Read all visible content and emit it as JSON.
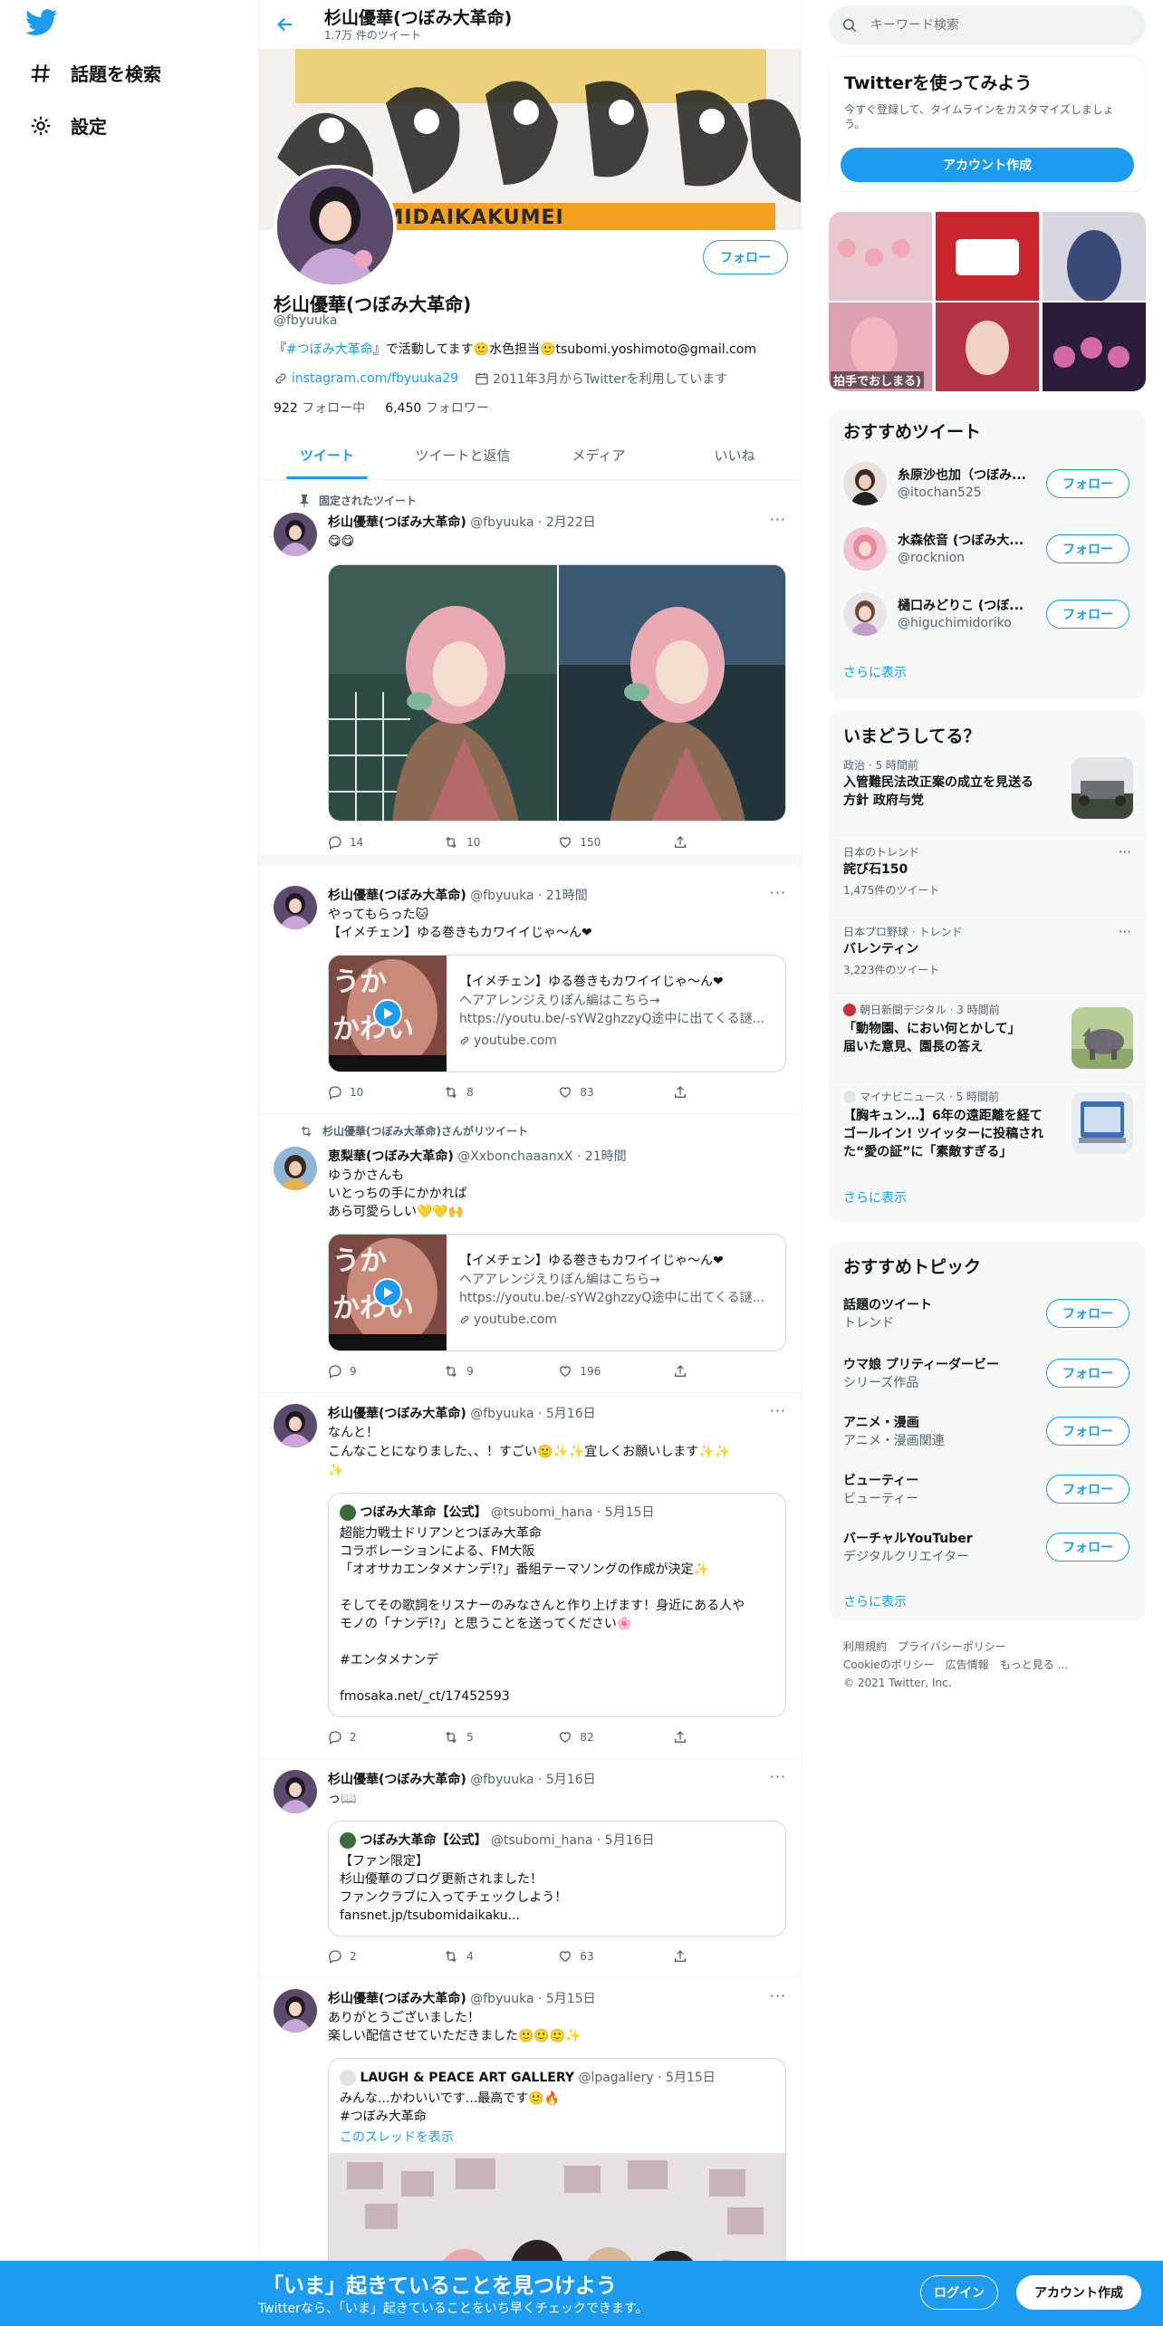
{
  "nav": {
    "explore_label": "話題を検索",
    "settings_label": "設定"
  },
  "header": {
    "name": "杉山優華(つぼみ大革命)",
    "tweet_count": "1.7万 件のツイート"
  },
  "banner": {
    "text": "BOMIDAIKAKUMEI"
  },
  "profile": {
    "name": "杉山優華(つぼみ大革命)",
    "handle": "@fbyuuka",
    "follow_label": "フォロー",
    "bio_prefix": "『",
    "bio_hashtag": "#つぼみ大革命",
    "bio_rest": "』で活動してます🙂水色担当🙂tsubomi.yoshimoto@gmail.com",
    "link": "instagram.com/fbyuuka29",
    "joined": "2011年3月からTwitterを利用しています",
    "following_count": "922",
    "following_label": "フォロー中",
    "followers_count": "6,450",
    "followers_label": "フォロワー"
  },
  "tabs": [
    "ツイート",
    "ツイートと返信",
    "メディア",
    "いいね"
  ],
  "tweets": [
    {
      "pinned_label": "固定されたツイート",
      "name": "杉山優華(つぼみ大革命)",
      "meta": "@fbyuuka · 2月22日",
      "text": "😋😋",
      "reply": "14",
      "retweet": "10",
      "like": "150"
    },
    {
      "name": "杉山優華(つぼみ大革命)",
      "meta": "@fbyuuka · 21時間",
      "text": "やってもらった🐱\n【イメチェン】ゆる巻きもカワイイじゃ〜ん❤",
      "card_thumb_text": "うか\nかわい",
      "card_title": "【イメチェン】ゆる巻きもカワイイじゃ〜ん❤",
      "card_desc": "ヘアアレンジえりぽん編はこちら→\nhttps://youtu.be/-sYW2ghzzyQ途中に出てくる謎...",
      "card_url": "youtube.com",
      "reply": "10",
      "retweet": "8",
      "like": "83"
    },
    {
      "social": "杉山優華(つぼみ大革命)さんがリツイート",
      "name": "恵梨華(つぼみ大革命)",
      "meta": "@XxbonchaaanxX · 21時間",
      "text": "ゆうかさんも\nいとっちの手にかかれば\nあら可愛らしい💛💛🙌",
      "card_thumb_text": "うか\nかわい",
      "card_title": "【イメチェン】ゆる巻きもカワイイじゃ〜ん❤",
      "card_desc": "ヘアアレンジえりぽん編はこちら→\nhttps://youtu.be/-sYW2ghzzyQ途中に出てくる謎...",
      "card_url": "youtube.com",
      "reply": "9",
      "retweet": "9",
      "like": "196"
    },
    {
      "name": "杉山優華(つぼみ大革命)",
      "meta": "@fbyuuka · 5月16日",
      "text": "なんと！\nこんなことになりました、、！すごい🙂✨✨宜しくお願いします✨✨\n✨",
      "quote_name": "つぼみ大革命【公式】",
      "quote_meta": "@tsubomi_hana · 5月15日",
      "quote_text": "超能力戦士ドリアンとつぼみ大革命\nコラボレーションによる、FM大阪\n「オオサカエンタメナンデ!?」番組テーマソングの作成が決定✨\n\nそしてその歌詞をリスナーのみなさんと作り上げます！身近にある人や\nモノの「ナンデ!?」と思うことを送ってください🌸\n\n#エンタメナンデ\n\nfmosaka.net/_ct/17452593",
      "reply": "2",
      "retweet": "5",
      "like": "82"
    },
    {
      "name": "杉山優華(つぼみ大革命)",
      "meta": "@fbyuuka · 5月16日",
      "text": "っ📖",
      "quote_name": "つぼみ大革命【公式】",
      "quote_meta": "@tsubomi_hana · 5月16日",
      "quote_text": "【ファン限定】\n杉山優華のブログ更新されました！\nファンクラブに入ってチェックしよう！\nfansnet.jp/tsubomidaikaku...",
      "reply": "2",
      "retweet": "4",
      "like": "63"
    },
    {
      "name": "杉山優華(つぼみ大革命)",
      "meta": "@fbyuuka · 5月15日",
      "text": "ありがとうございました！\n楽しい配信させていただきました🙂🙂🙂✨",
      "quote_name": "LAUGH & PEACE ART GALLERY",
      "quote_meta": "@lpagallery · 5月15日",
      "quote_text": "みんな...かわいいです...最高です🙂🔥\n#つぼみ大革命",
      "quote_thread": "このスレッドを表示"
    }
  ],
  "sidebar": {
    "search_placeholder": "キーワード検索",
    "signup": {
      "title": "Twitterを使ってみよう",
      "desc": "今すぐ登録して、タイムラインをカスタマイズしましょう。",
      "button": "アカウント作成"
    },
    "media_caption": "拍手でおしまる)",
    "recommended": {
      "title": "おすすめツイート",
      "follow_label": "フォロー",
      "users": [
        {
          "name": "糸原沙也加（つぼみ...",
          "handle": "@itochan525"
        },
        {
          "name": "水森依音 (つぼみ大...",
          "handle": "@rocknion"
        },
        {
          "name": "樋口みどりこ (つぼ...",
          "handle": "@higuchimidoriko"
        }
      ],
      "more": "さらに表示"
    },
    "trends": {
      "title": "いまどうしてる？",
      "items": [
        {
          "meta": "政治 · 5 時間前",
          "title": "入管難民法改正案の成立を見送る\n方針 政府与党"
        },
        {
          "meta": "日本のトレンド",
          "title": "詫び石150",
          "count": "1,475件のツイート"
        },
        {
          "meta": "日本プロ野球 · トレンド",
          "title": "バレンティン",
          "count": "3,223件のツイート"
        },
        {
          "meta": "朝日新聞デジタル · 3 時間前",
          "title": "「動物園、におい何とかして」\n届いた意見、園長の答え"
        },
        {
          "meta": "マイナビニュース · 5 時間前",
          "title": "【胸キュン…】6年の遠距離を経て\nゴールイン! ツイッターに投稿され\nた“愛の証”に「素敵すぎる」"
        }
      ],
      "more": "さらに表示"
    },
    "topics": {
      "title": "おすすめトピック",
      "follow_label": "フォロー",
      "items": [
        {
          "name": "話題のツイート",
          "sub": "トレンド"
        },
        {
          "name": "ウマ娘 プリティーダービー",
          "sub": "シリーズ作品"
        },
        {
          "name": "アニメ・漫画",
          "sub": "アニメ・漫画関連"
        },
        {
          "name": "ビューティー",
          "sub": "ビューティー"
        },
        {
          "name": "バーチャルYouTuber",
          "sub": "デジタルクリエイター"
        }
      ],
      "more": "さらに表示"
    },
    "footer": {
      "terms": "利用規約",
      "privacy": "プライバシーポリシー",
      "cookie": "Cookieのポリシー",
      "ads": "広告情報",
      "more": "もっと見る ...",
      "copyright": "© 2021 Twitter, Inc."
    }
  },
  "bottom": {
    "title": "「いま」起きていることを見つけよう",
    "subtitle": "Twitterなら、「いま」起きていることをいち早くチェックできます。",
    "login": "ログイン",
    "signup": "アカウント作成"
  },
  "colors": {
    "accent": "#1d9bf0",
    "text": "#0f1419",
    "muted": "#536471"
  }
}
